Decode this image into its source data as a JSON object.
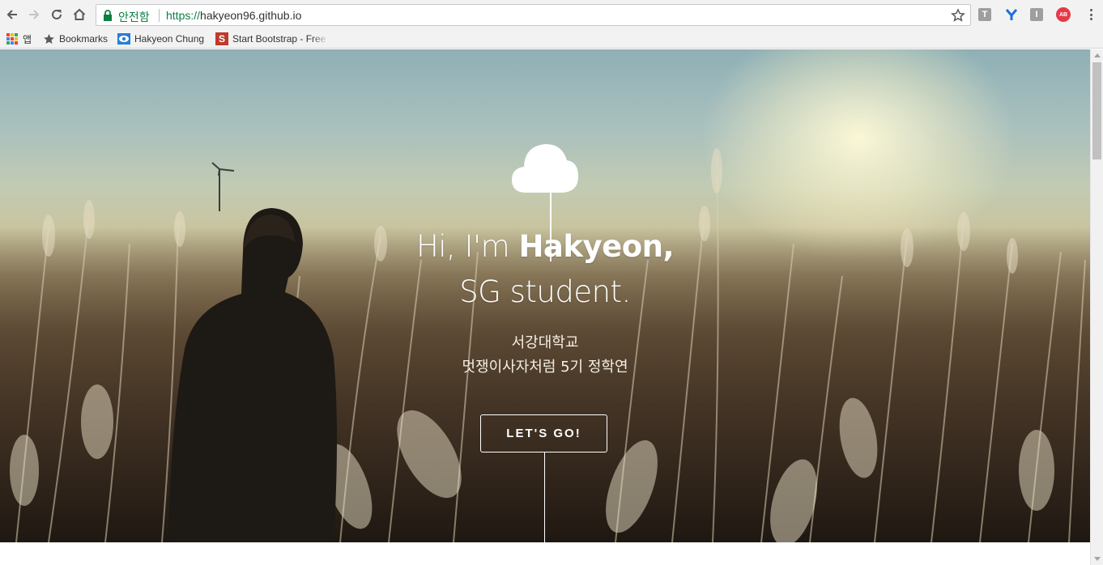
{
  "browser": {
    "secure_label": "안전함",
    "url_scheme": "https://",
    "url_host": "hakyeon96.github.io",
    "extensions": {
      "t_label": "T",
      "i_label": "I",
      "ab_label": "AB"
    }
  },
  "bookmarks": {
    "apps_label": "앱",
    "items": [
      {
        "label": "Bookmarks",
        "icon": "star-icon"
      },
      {
        "label": "Hakyeon Chung",
        "icon": "eye-favicon"
      },
      {
        "label": "Start Bootstrap - Free",
        "icon": "s-favicon",
        "icon_letter": "S"
      }
    ]
  },
  "hero": {
    "greeting": "Hi, I'm ",
    "name": "Hakyeon,",
    "role": "SG student.",
    "school": "서강대학교",
    "club": "멋쟁이사자처럼 5기 정학연",
    "cta_label": "LET'S GO!"
  },
  "colors": {
    "secure_green": "#0b8043",
    "ab_red": "#e53949",
    "hero_text": "#ffffff"
  }
}
